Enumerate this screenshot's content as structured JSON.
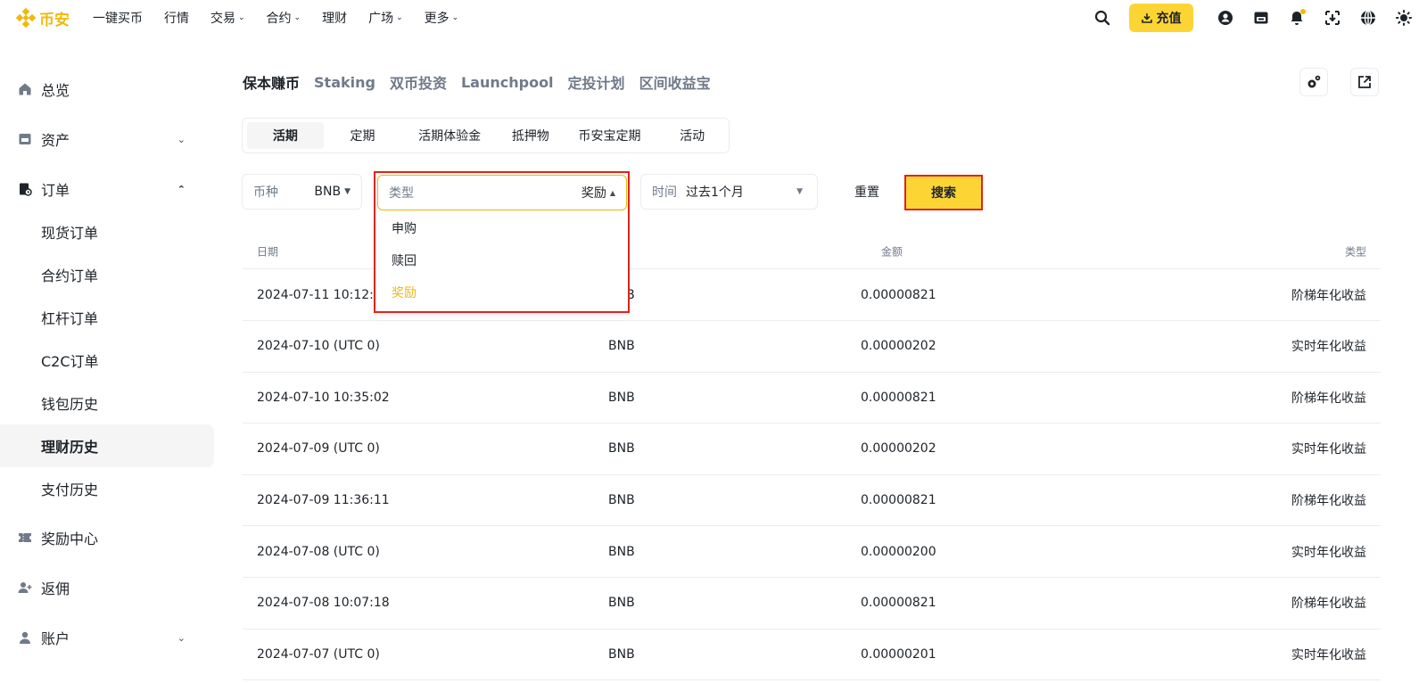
{
  "header": {
    "logo_text": "币安",
    "nav": [
      "一键买币",
      "行情",
      "交易",
      "合约",
      "理财",
      "广场",
      "更多"
    ],
    "nav_has_dropdown": [
      false,
      false,
      true,
      true,
      false,
      true,
      true
    ],
    "deposit_label": "充值",
    "icons": [
      "search-icon",
      "user-icon",
      "wallet-icon",
      "bell-icon",
      "download-app-icon",
      "globe-icon",
      "theme-icon"
    ],
    "brand_color": "#f0b90b"
  },
  "sidebar": {
    "overview": "总览",
    "assets": "资产",
    "orders": "订单",
    "order_items": [
      "现货订单",
      "合约订单",
      "杠杆订单",
      "C2C订单",
      "钱包历史",
      "理财历史",
      "支付历史"
    ],
    "active_item": "理财历史",
    "rewards": "奖励中心",
    "referral": "返佣",
    "account": "账户"
  },
  "main": {
    "tabs": [
      "保本赚币",
      "Staking",
      "双币投资",
      "Launchpool",
      "定投计划",
      "区间收益宝"
    ],
    "active_tab": "保本赚币",
    "sub_tabs": [
      "活期",
      "定期",
      "活期体验金",
      "抵押物",
      "币安宝定期",
      "活动"
    ],
    "active_sub_tab": "活期"
  },
  "filters": {
    "coin_label": "币种",
    "coin_value": "BNB",
    "type_label": "类型",
    "type_value": "奖励",
    "type_options": [
      "申购",
      "赎回",
      "奖励"
    ],
    "time_label": "时间",
    "time_value": "过去1个月",
    "reset_label": "重置",
    "search_label": "搜索"
  },
  "table": {
    "headers": {
      "date": "日期",
      "amount": "金额",
      "type": "类型"
    },
    "rows": [
      {
        "date": "2024-07-11 10:12:16",
        "coin": "BNB",
        "amount": "0.00000821",
        "type": "阶梯年化收益"
      },
      {
        "date": "2024-07-10 (UTC 0)",
        "coin": "BNB",
        "amount": "0.00000202",
        "type": "实时年化收益"
      },
      {
        "date": "2024-07-10 10:35:02",
        "coin": "BNB",
        "amount": "0.00000821",
        "type": "阶梯年化收益"
      },
      {
        "date": "2024-07-09 (UTC 0)",
        "coin": "BNB",
        "amount": "0.00000202",
        "type": "实时年化收益"
      },
      {
        "date": "2024-07-09 11:36:11",
        "coin": "BNB",
        "amount": "0.00000821",
        "type": "阶梯年化收益"
      },
      {
        "date": "2024-07-08 (UTC 0)",
        "coin": "BNB",
        "amount": "0.00000200",
        "type": "实时年化收益"
      },
      {
        "date": "2024-07-08 10:07:18",
        "coin": "BNB",
        "amount": "0.00000821",
        "type": "阶梯年化收益"
      },
      {
        "date": "2024-07-07 (UTC 0)",
        "coin": "BNB",
        "amount": "0.00000201",
        "type": "实时年化收益"
      }
    ]
  }
}
